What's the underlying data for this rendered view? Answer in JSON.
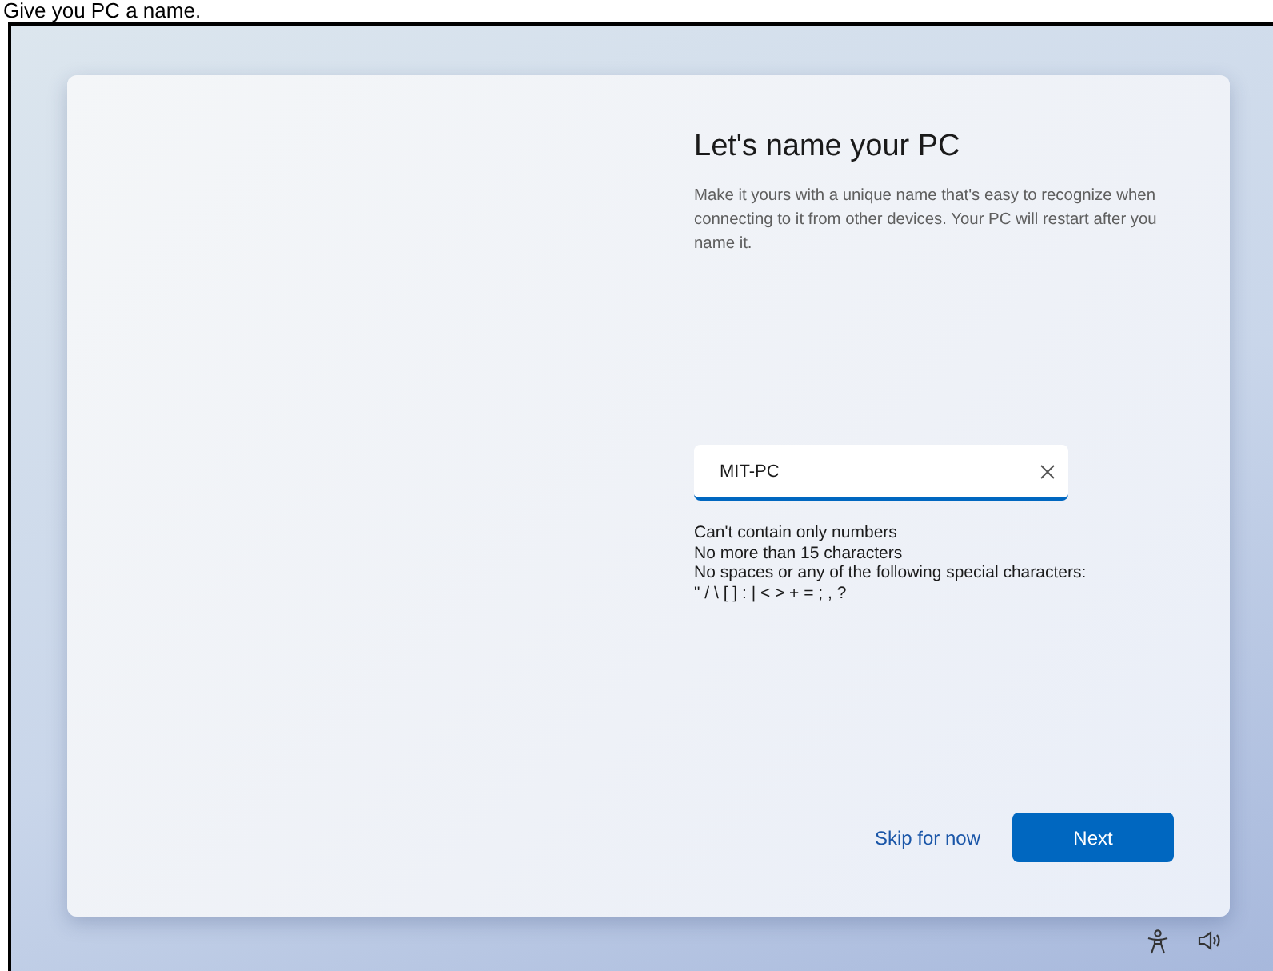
{
  "caption": "Give you PC a name.",
  "setup": {
    "title": "Let's name your PC",
    "description": "Make it yours with a unique name that's easy to recognize when connecting to it from other devices. Your PC will restart after you name it.",
    "name_field": {
      "value": "MIT-PC"
    },
    "rules": [
      "Can't contain only numbers",
      "No more than 15 characters",
      "No spaces or any of the following special characters:",
      "\" / \\ [ ] : | < > + = ; , ?"
    ],
    "skip_link": "Skip for now",
    "next_button": "Next"
  }
}
